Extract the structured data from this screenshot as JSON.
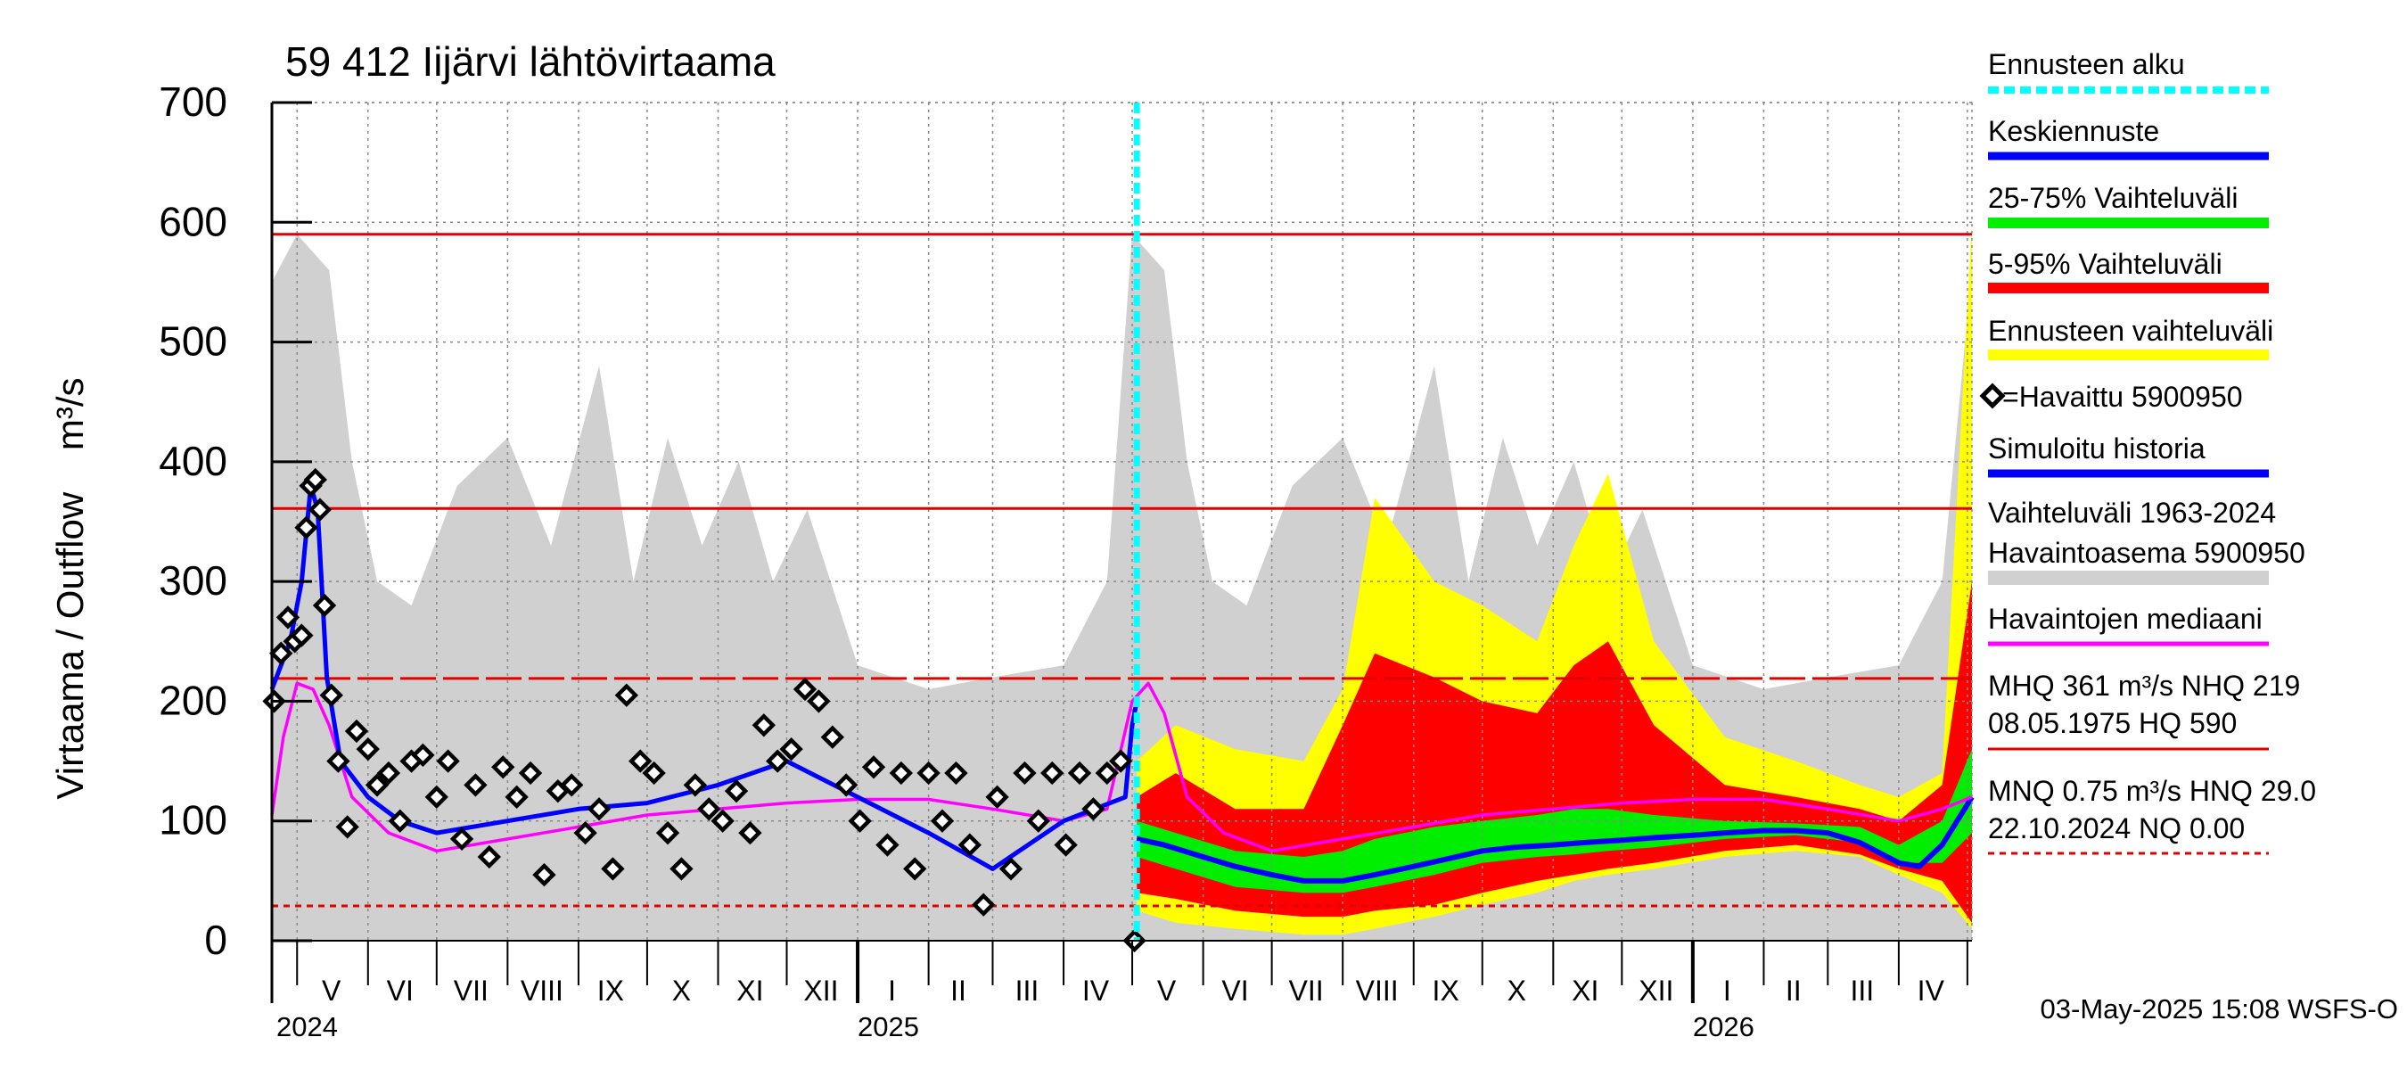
{
  "chart_data": {
    "type": "area",
    "title": "59 412 Iijärvi lähtövirtaama",
    "ylabel": "Virtaama / Outflow    m³/s",
    "ylim": [
      0,
      700
    ],
    "yticks": [
      0,
      100,
      200,
      300,
      400,
      500,
      600,
      700
    ],
    "grid": true,
    "xlim": [
      "2024-04-20",
      "2026-05-03"
    ],
    "month_labels": [
      {
        "label": "V",
        "mid": "2024-05-16"
      },
      {
        "label": "VI",
        "mid": "2024-06-15"
      },
      {
        "label": "VII",
        "mid": "2024-07-16"
      },
      {
        "label": "VIII",
        "mid": "2024-08-16"
      },
      {
        "label": "IX",
        "mid": "2024-09-15"
      },
      {
        "label": "X",
        "mid": "2024-10-16"
      },
      {
        "label": "XI",
        "mid": "2024-11-15"
      },
      {
        "label": "XII",
        "mid": "2024-12-16"
      },
      {
        "label": "I",
        "mid": "2025-01-16"
      },
      {
        "label": "II",
        "mid": "2025-02-14"
      },
      {
        "label": "III",
        "mid": "2025-03-16"
      },
      {
        "label": "IV",
        "mid": "2025-04-15"
      },
      {
        "label": "V",
        "mid": "2025-05-16"
      },
      {
        "label": "VI",
        "mid": "2025-06-15"
      },
      {
        "label": "VII",
        "mid": "2025-07-16"
      },
      {
        "label": "VIII",
        "mid": "2025-08-16"
      },
      {
        "label": "IX",
        "mid": "2025-09-15"
      },
      {
        "label": "X",
        "mid": "2025-10-16"
      },
      {
        "label": "XI",
        "mid": "2025-11-15"
      },
      {
        "label": "XII",
        "mid": "2025-12-16"
      },
      {
        "label": "I",
        "mid": "2026-01-16"
      },
      {
        "label": "II",
        "mid": "2026-02-14"
      },
      {
        "label": "III",
        "mid": "2026-03-16"
      },
      {
        "label": "IV",
        "mid": "2026-04-15"
      }
    ],
    "month_starts": [
      "2024-05-01",
      "2024-06-01",
      "2024-07-01",
      "2024-08-01",
      "2024-09-01",
      "2024-10-01",
      "2024-11-01",
      "2024-12-01",
      "2025-01-01",
      "2025-02-01",
      "2025-03-01",
      "2025-04-01",
      "2025-05-01",
      "2025-06-01",
      "2025-07-01",
      "2025-08-01",
      "2025-09-01",
      "2025-10-01",
      "2025-11-01",
      "2025-12-01",
      "2026-01-01",
      "2026-02-01",
      "2026-03-01",
      "2026-04-01",
      "2026-05-01"
    ],
    "year_labels": [
      {
        "label": "2024",
        "date": "2024-04-20"
      },
      {
        "label": "2025",
        "date": "2025-01-01"
      },
      {
        "label": "2026",
        "date": "2026-01-01"
      }
    ],
    "forecast_start": "2025-05-03",
    "reference_lines": [
      {
        "name": "HQ",
        "value": 590,
        "style": "solid",
        "color": "#e00000"
      },
      {
        "name": "MHQ",
        "value": 361,
        "style": "solid",
        "color": "#e00000"
      },
      {
        "name": "NHQ",
        "value": 219,
        "style": "dashed",
        "color": "#e00000"
      },
      {
        "name": "HNQ",
        "value": 29.0,
        "style": "dotted",
        "color": "#e00000"
      }
    ],
    "colors": {
      "history_range": "#d0d0d0",
      "forecast_range": "#ffff00",
      "range_5_95": "#ff0000",
      "range_25_75": "#00ee00",
      "mean_forecast": "#0000ff",
      "simulated": "#0000ff",
      "median": "#ff00ff",
      "forecast_start": "#00ffff",
      "observed": "#000000"
    },
    "series": [
      {
        "name": "Vaihteluväli 1963-2024 Havaintoasema 5900950",
        "kind": "band",
        "x": [
          "2024-04-20",
          "2024-05-01",
          "2024-05-15",
          "2024-05-25",
          "2024-06-05",
          "2024-06-20",
          "2024-07-10",
          "2024-08-01",
          "2024-08-20",
          "2024-09-10",
          "2024-09-25",
          "2024-10-10",
          "2024-10-25",
          "2024-11-10",
          "2024-11-25",
          "2024-12-10",
          "2025-01-01",
          "2025-02-01",
          "2025-03-01",
          "2025-04-01",
          "2025-04-20",
          "2025-05-01",
          "2025-05-15",
          "2025-05-25",
          "2025-06-05",
          "2025-06-20",
          "2025-07-10",
          "2025-08-01",
          "2025-08-20",
          "2025-09-10",
          "2025-09-25",
          "2025-10-10",
          "2025-10-25",
          "2025-11-10",
          "2025-11-25",
          "2025-12-10",
          "2026-01-01",
          "2026-02-01",
          "2026-03-01",
          "2026-04-01",
          "2026-04-20",
          "2026-05-03"
        ],
        "low": [
          0,
          0,
          0,
          0,
          0,
          0,
          0,
          0,
          0,
          0,
          0,
          0,
          0,
          0,
          0,
          0,
          0,
          0,
          0,
          0,
          0,
          0,
          0,
          0,
          0,
          0,
          0,
          0,
          0,
          0,
          0,
          0,
          0,
          0,
          0,
          0,
          0,
          0,
          0,
          0,
          0,
          0
        ],
        "high": [
          550,
          590,
          560,
          400,
          300,
          280,
          380,
          420,
          330,
          480,
          300,
          420,
          330,
          400,
          300,
          360,
          230,
          210,
          220,
          230,
          300,
          590,
          560,
          400,
          300,
          280,
          380,
          420,
          330,
          480,
          300,
          420,
          330,
          400,
          300,
          360,
          230,
          210,
          220,
          230,
          300,
          560
        ]
      },
      {
        "name": "Ennusteen vaihteluväli",
        "kind": "band",
        "x": [
          "2025-05-03",
          "2025-05-20",
          "2025-06-15",
          "2025-07-15",
          "2025-08-01",
          "2025-08-15",
          "2025-09-10",
          "2025-10-01",
          "2025-10-25",
          "2025-11-10",
          "2025-11-25",
          "2025-12-15",
          "2026-01-15",
          "2026-02-15",
          "2026-03-15",
          "2026-04-01",
          "2026-04-20",
          "2026-05-03"
        ],
        "low": [
          25,
          15,
          10,
          5,
          5,
          10,
          20,
          30,
          40,
          50,
          55,
          60,
          70,
          75,
          70,
          55,
          40,
          10
        ],
        "high": [
          150,
          180,
          160,
          150,
          210,
          370,
          300,
          280,
          250,
          330,
          390,
          250,
          170,
          150,
          130,
          120,
          140,
          600
        ]
      },
      {
        "name": "5-95% Vaihteluväli",
        "kind": "band",
        "x": [
          "2025-05-03",
          "2025-05-20",
          "2025-06-15",
          "2025-07-15",
          "2025-08-01",
          "2025-08-15",
          "2025-09-10",
          "2025-10-01",
          "2025-10-25",
          "2025-11-10",
          "2025-11-25",
          "2025-12-15",
          "2026-01-15",
          "2026-02-15",
          "2026-03-15",
          "2026-04-01",
          "2026-04-20",
          "2026-05-03"
        ],
        "low": [
          40,
          35,
          25,
          20,
          20,
          25,
          30,
          40,
          50,
          55,
          60,
          65,
          75,
          80,
          72,
          60,
          50,
          15
        ],
        "high": [
          120,
          140,
          110,
          110,
          180,
          240,
          220,
          200,
          190,
          230,
          250,
          180,
          130,
          120,
          110,
          100,
          130,
          300
        ]
      },
      {
        "name": "25-75% Vaihteluväli",
        "kind": "band",
        "x": [
          "2025-05-03",
          "2025-05-20",
          "2025-06-15",
          "2025-07-15",
          "2025-08-01",
          "2025-08-15",
          "2025-09-10",
          "2025-10-01",
          "2025-10-25",
          "2025-11-10",
          "2025-11-25",
          "2025-12-15",
          "2026-01-15",
          "2026-02-15",
          "2026-03-15",
          "2026-04-01",
          "2026-04-20",
          "2026-05-03"
        ],
        "low": [
          70,
          60,
          45,
          40,
          40,
          45,
          55,
          65,
          70,
          72,
          75,
          78,
          85,
          88,
          82,
          65,
          65,
          90
        ],
        "high": [
          100,
          90,
          75,
          70,
          75,
          85,
          95,
          100,
          105,
          110,
          110,
          105,
          100,
          98,
          95,
          80,
          100,
          160
        ]
      },
      {
        "name": "Keskiennuste",
        "kind": "line",
        "x": [
          "2025-05-03",
          "2025-05-15",
          "2025-06-01",
          "2025-06-15",
          "2025-07-01",
          "2025-07-15",
          "2025-08-01",
          "2025-08-15",
          "2025-09-01",
          "2025-09-15",
          "2025-10-01",
          "2025-10-15",
          "2025-11-01",
          "2025-11-15",
          "2025-12-01",
          "2025-12-15",
          "2026-01-01",
          "2026-01-15",
          "2026-02-01",
          "2026-02-15",
          "2026-03-01",
          "2026-03-15",
          "2026-04-01",
          "2026-04-10",
          "2026-04-20",
          "2026-05-03"
        ],
        "y": [
          85,
          80,
          70,
          62,
          55,
          50,
          50,
          55,
          62,
          68,
          75,
          78,
          80,
          82,
          84,
          86,
          88,
          90,
          92,
          92,
          90,
          82,
          65,
          62,
          80,
          120
        ]
      },
      {
        "name": "Havaintojen mediaani",
        "kind": "line",
        "x": [
          "2024-04-20",
          "2024-04-25",
          "2024-05-01",
          "2024-05-08",
          "2024-05-15",
          "2024-05-25",
          "2024-06-10",
          "2024-07-01",
          "2024-08-01",
          "2024-09-01",
          "2024-10-01",
          "2024-11-01",
          "2024-12-01",
          "2025-01-01",
          "2025-02-01",
          "2025-03-01",
          "2025-04-01",
          "2025-04-20",
          "2025-05-01",
          "2025-05-08",
          "2025-05-15",
          "2025-05-25",
          "2025-06-10",
          "2025-07-01",
          "2025-08-01",
          "2025-09-01",
          "2025-10-01",
          "2025-11-01",
          "2025-12-01",
          "2026-01-01",
          "2026-02-01",
          "2026-03-01",
          "2026-04-01",
          "2026-04-20",
          "2026-05-03"
        ],
        "y": [
          105,
          170,
          215,
          210,
          180,
          120,
          90,
          75,
          85,
          95,
          105,
          110,
          115,
          118,
          118,
          110,
          100,
          110,
          200,
          215,
          190,
          120,
          90,
          75,
          85,
          95,
          105,
          110,
          115,
          118,
          118,
          110,
          100,
          110,
          120
        ]
      },
      {
        "name": "Simuloitu historia",
        "kind": "line",
        "x": [
          "2024-04-20",
          "2024-04-28",
          "2024-05-03",
          "2024-05-07",
          "2024-05-10",
          "2024-05-14",
          "2024-05-20",
          "2024-06-01",
          "2024-06-15",
          "2024-07-01",
          "2024-08-01",
          "2024-09-01",
          "2024-10-01",
          "2024-11-01",
          "2024-12-01",
          "2025-01-01",
          "2025-02-01",
          "2025-03-01",
          "2025-04-01",
          "2025-04-28",
          "2025-05-01",
          "2025-05-03"
        ],
        "y": [
          210,
          250,
          300,
          380,
          360,
          220,
          150,
          120,
          100,
          90,
          100,
          110,
          115,
          130,
          150,
          120,
          90,
          60,
          100,
          120,
          180,
          200
        ]
      }
    ],
    "observed": {
      "name": "=Havaittu 5900950",
      "x": [
        "2024-04-21",
        "2024-04-24",
        "2024-04-27",
        "2024-04-30",
        "2024-05-03",
        "2024-05-05",
        "2024-05-07",
        "2024-05-09",
        "2024-05-11",
        "2024-05-13",
        "2024-05-16",
        "2024-05-19",
        "2024-05-23",
        "2024-05-27",
        "2024-06-01",
        "2024-06-05",
        "2024-06-10",
        "2024-06-15",
        "2024-06-20",
        "2024-06-25",
        "2024-07-01",
        "2024-07-06",
        "2024-07-12",
        "2024-07-18",
        "2024-07-24",
        "2024-07-30",
        "2024-08-05",
        "2024-08-11",
        "2024-08-17",
        "2024-08-23",
        "2024-08-29",
        "2024-09-04",
        "2024-09-10",
        "2024-09-16",
        "2024-09-22",
        "2024-09-28",
        "2024-10-04",
        "2024-10-10",
        "2024-10-16",
        "2024-10-22",
        "2024-10-28",
        "2024-11-03",
        "2024-11-09",
        "2024-11-15",
        "2024-11-21",
        "2024-11-27",
        "2024-12-03",
        "2024-12-09",
        "2024-12-15",
        "2024-12-21",
        "2024-12-27",
        "2025-01-02",
        "2025-01-08",
        "2025-01-14",
        "2025-01-20",
        "2025-01-26",
        "2025-02-01",
        "2025-02-07",
        "2025-02-13",
        "2025-02-19",
        "2025-02-25",
        "2025-03-03",
        "2025-03-09",
        "2025-03-15",
        "2025-03-21",
        "2025-03-27",
        "2025-04-02",
        "2025-04-08",
        "2025-04-14",
        "2025-04-20",
        "2025-04-26",
        "2025-05-02"
      ],
      "y": [
        200,
        240,
        270,
        250,
        255,
        345,
        380,
        385,
        360,
        280,
        205,
        150,
        95,
        175,
        160,
        130,
        140,
        100,
        150,
        155,
        120,
        150,
        85,
        130,
        70,
        145,
        120,
        140,
        55,
        125,
        130,
        90,
        110,
        60,
        205,
        150,
        140,
        90,
        60,
        130,
        110,
        100,
        125,
        90,
        180,
        150,
        160,
        210,
        200,
        170,
        130,
        100,
        145,
        80,
        140,
        60,
        140,
        100,
        140,
        80,
        30,
        120,
        60,
        140,
        100,
        140,
        80,
        140,
        110,
        140,
        150,
        0
      ]
    }
  },
  "legend": [
    {
      "key": "forecast_start",
      "label": "Ennusteen alku"
    },
    {
      "key": "mean",
      "label": "Keskiennuste"
    },
    {
      "key": "q25_75",
      "label": "25-75% Vaihteluväli"
    },
    {
      "key": "q5_95",
      "label": "5-95% Vaihteluväli"
    },
    {
      "key": "forecast_range",
      "label": "Ennusteen vaihteluväli"
    },
    {
      "key": "observed",
      "label": "=Havaittu 5900950"
    },
    {
      "key": "simulated",
      "label": "Simuloitu historia"
    },
    {
      "key": "history",
      "label": "Vaihteluväli 1963-2024",
      "label2": " Havaintoasema 5900950"
    },
    {
      "key": "median",
      "label": "Havaintojen mediaani"
    },
    {
      "key": "stats_high",
      "label": "MHQ  361 m³/s NHQ  219",
      "label2": "08.05.1975 HQ  590"
    },
    {
      "key": "stats_low",
      "label": "MNQ 0.75 m³/s HNQ 29.0",
      "label2": "22.10.2024 NQ 0.00"
    }
  ],
  "footer": "03-May-2025 15:08 WSFS-O"
}
